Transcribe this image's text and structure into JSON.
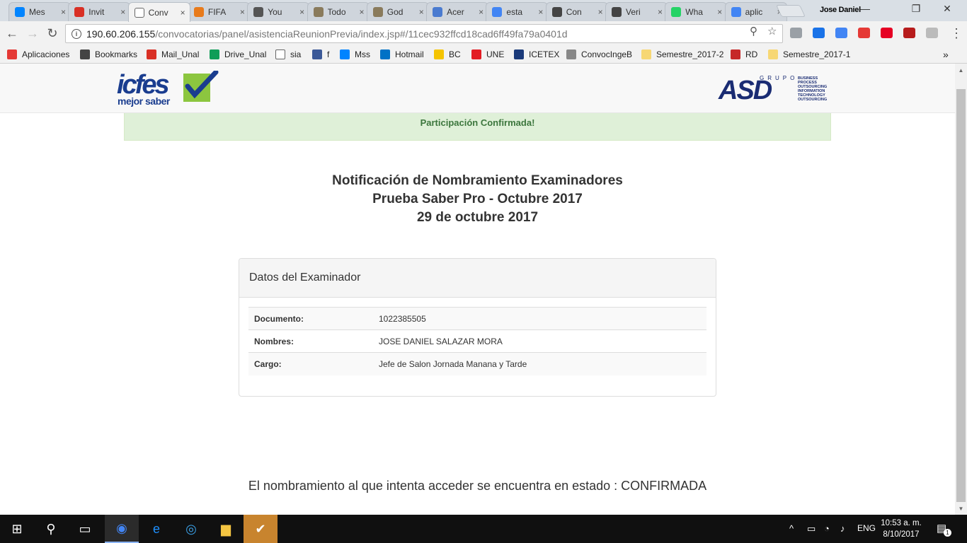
{
  "browser": {
    "tabs": [
      {
        "title": "Mes",
        "icon": "messenger-icon",
        "color": "#0084ff"
      },
      {
        "title": "Invit",
        "icon": "gmail-icon",
        "color": "#d93025"
      },
      {
        "title": "Conv",
        "icon": "document-icon",
        "color": "#ffffff",
        "active": true
      },
      {
        "title": "FIFA",
        "icon": "fifa-icon",
        "color": "#e87b1c"
      },
      {
        "title": "You",
        "icon": "youtube-icon",
        "color": "#555555"
      },
      {
        "title": "Todo",
        "icon": "pirate-icon",
        "color": "#8a7b5c"
      },
      {
        "title": "God",
        "icon": "pirate-icon",
        "color": "#8a7b5c"
      },
      {
        "title": "Acer",
        "icon": "document-blue-icon",
        "color": "#4a7bd0"
      },
      {
        "title": "esta",
        "icon": "google-icon",
        "color": "#4285f4"
      },
      {
        "title": "Con",
        "icon": "hexagon-icon",
        "color": "#444444"
      },
      {
        "title": "Veri",
        "icon": "hexagon-icon",
        "color": "#444444"
      },
      {
        "title": "Wha",
        "icon": "whatsapp-icon",
        "color": "#25d366"
      },
      {
        "title": "aplic",
        "icon": "google-icon",
        "color": "#4285f4"
      }
    ],
    "close_glyph": "×",
    "profile_name": "Jose Daniel",
    "window_controls": {
      "minimize": "—",
      "restore": "❐",
      "close": "✕"
    },
    "nav": {
      "back": "←",
      "forward": "→",
      "reload": "↻",
      "zoom": "⚲",
      "star": "☆",
      "menu": "⋮"
    },
    "info_glyph": "i",
    "url_host": "190.60.206.155",
    "url_path": "/convocatorias/panel/asistenciaReunionPrevia/index.jsp#/11cec932ffcd18cad6ff49fa79a0401d",
    "extensions": [
      {
        "name": "cloud-extension-icon",
        "color": "#9aa0a6"
      },
      {
        "name": "calendar-extension-icon",
        "color": "#1a73e8"
      },
      {
        "name": "translate-extension-icon",
        "color": "#4285f4"
      },
      {
        "name": "video-extension-icon",
        "color": "#e53935"
      },
      {
        "name": "pinterest-extension-icon",
        "color": "#e60023"
      },
      {
        "name": "mendeley-extension-icon",
        "color": "#b71c1c"
      },
      {
        "name": "cast-extension-icon",
        "color": "#bbbbbb"
      }
    ],
    "bookmarks_overflow": "»",
    "bookmarks": [
      {
        "label": "Aplicaciones",
        "icon": "apps-grid-icon",
        "color": "#e53935"
      },
      {
        "label": "Bookmarks",
        "icon": "star-icon",
        "color": "#444444"
      },
      {
        "label": "Mail_Unal",
        "icon": "gmail-icon",
        "color": "#d93025"
      },
      {
        "label": "Drive_Unal",
        "icon": "drive-icon",
        "color": "#0f9d58"
      },
      {
        "label": "sia",
        "icon": "document-icon",
        "color": "#ffffff"
      },
      {
        "label": "f",
        "icon": "facebook-icon",
        "color": "#3b5998"
      },
      {
        "label": "Mss",
        "icon": "messenger-icon",
        "color": "#0084ff"
      },
      {
        "label": "Hotmail",
        "icon": "outlook-icon",
        "color": "#0072c6"
      },
      {
        "label": "BC",
        "icon": "bancolombia-icon",
        "color": "#f5c400"
      },
      {
        "label": "UNE",
        "icon": "une-icon",
        "color": "#e31c23"
      },
      {
        "label": "ICETEX",
        "icon": "icetex-icon",
        "color": "#1a3a7a"
      },
      {
        "label": "ConvocIngeB",
        "icon": "seal-icon",
        "color": "#888888"
      },
      {
        "label": "Semestre_2017-2",
        "icon": "folder-icon",
        "color": "#f7d774"
      },
      {
        "label": "RD",
        "icon": "rd-icon",
        "color": "#c62828"
      },
      {
        "label": "Semestre_2017-1",
        "icon": "folder-icon",
        "color": "#f7d774"
      }
    ]
  },
  "site": {
    "logo_left": {
      "word": "icfes",
      "tagline": "mejor saber"
    },
    "logo_right": {
      "grupo": "GRUPO",
      "word": "ASD",
      "lines": [
        "BUSINESS",
        "PROCESS",
        "OUTSOURCING",
        "INFORMATION",
        "TECHNOLOGY",
        "OUTSOURCING"
      ]
    },
    "alert": "Participación Confirmada!",
    "headline": {
      "line1": "Notificación de Nombramiento Examinadores",
      "line2": "Prueba Saber Pro - Octubre 2017",
      "line3": "29 de octubre 2017"
    },
    "panel": {
      "title": "Datos del Examinador",
      "rows": [
        {
          "label": "Documento:",
          "value": "1022385505"
        },
        {
          "label": "Nombres:",
          "value": "JOSE DANIEL SALAZAR MORA"
        },
        {
          "label": "Cargo:",
          "value": "Jefe de Salon Jornada Manana y Tarde"
        }
      ]
    },
    "status_message": "El nombramiento al que intenta acceder se encuentra en estado : CONFIRMADA"
  },
  "taskbar": {
    "start_glyph": "⊞",
    "search_glyph": "⚲",
    "taskview_glyph": "▭",
    "apps": [
      {
        "name": "chrome-taskbar-icon",
        "glyph": "◉",
        "color": "#4285f4",
        "active": true
      },
      {
        "name": "edge-taskbar-icon",
        "glyph": "e",
        "color": "#1e90ff"
      },
      {
        "name": "ie-taskbar-icon",
        "glyph": "◎",
        "color": "#3ba0e6"
      },
      {
        "name": "explorer-taskbar-icon",
        "glyph": "▆",
        "color": "#f4c542"
      },
      {
        "name": "app-taskbar-icon",
        "glyph": "✔",
        "color": "#6abf4b",
        "highlight": true
      }
    ],
    "tray": {
      "chevron": "^",
      "battery": "▭",
      "wifi": "◔",
      "volume": "♪",
      "language": "ENG",
      "notifications": "▤",
      "notification_count": "1"
    },
    "time": "10:53 a. m.",
    "date": "8/10/2017"
  }
}
